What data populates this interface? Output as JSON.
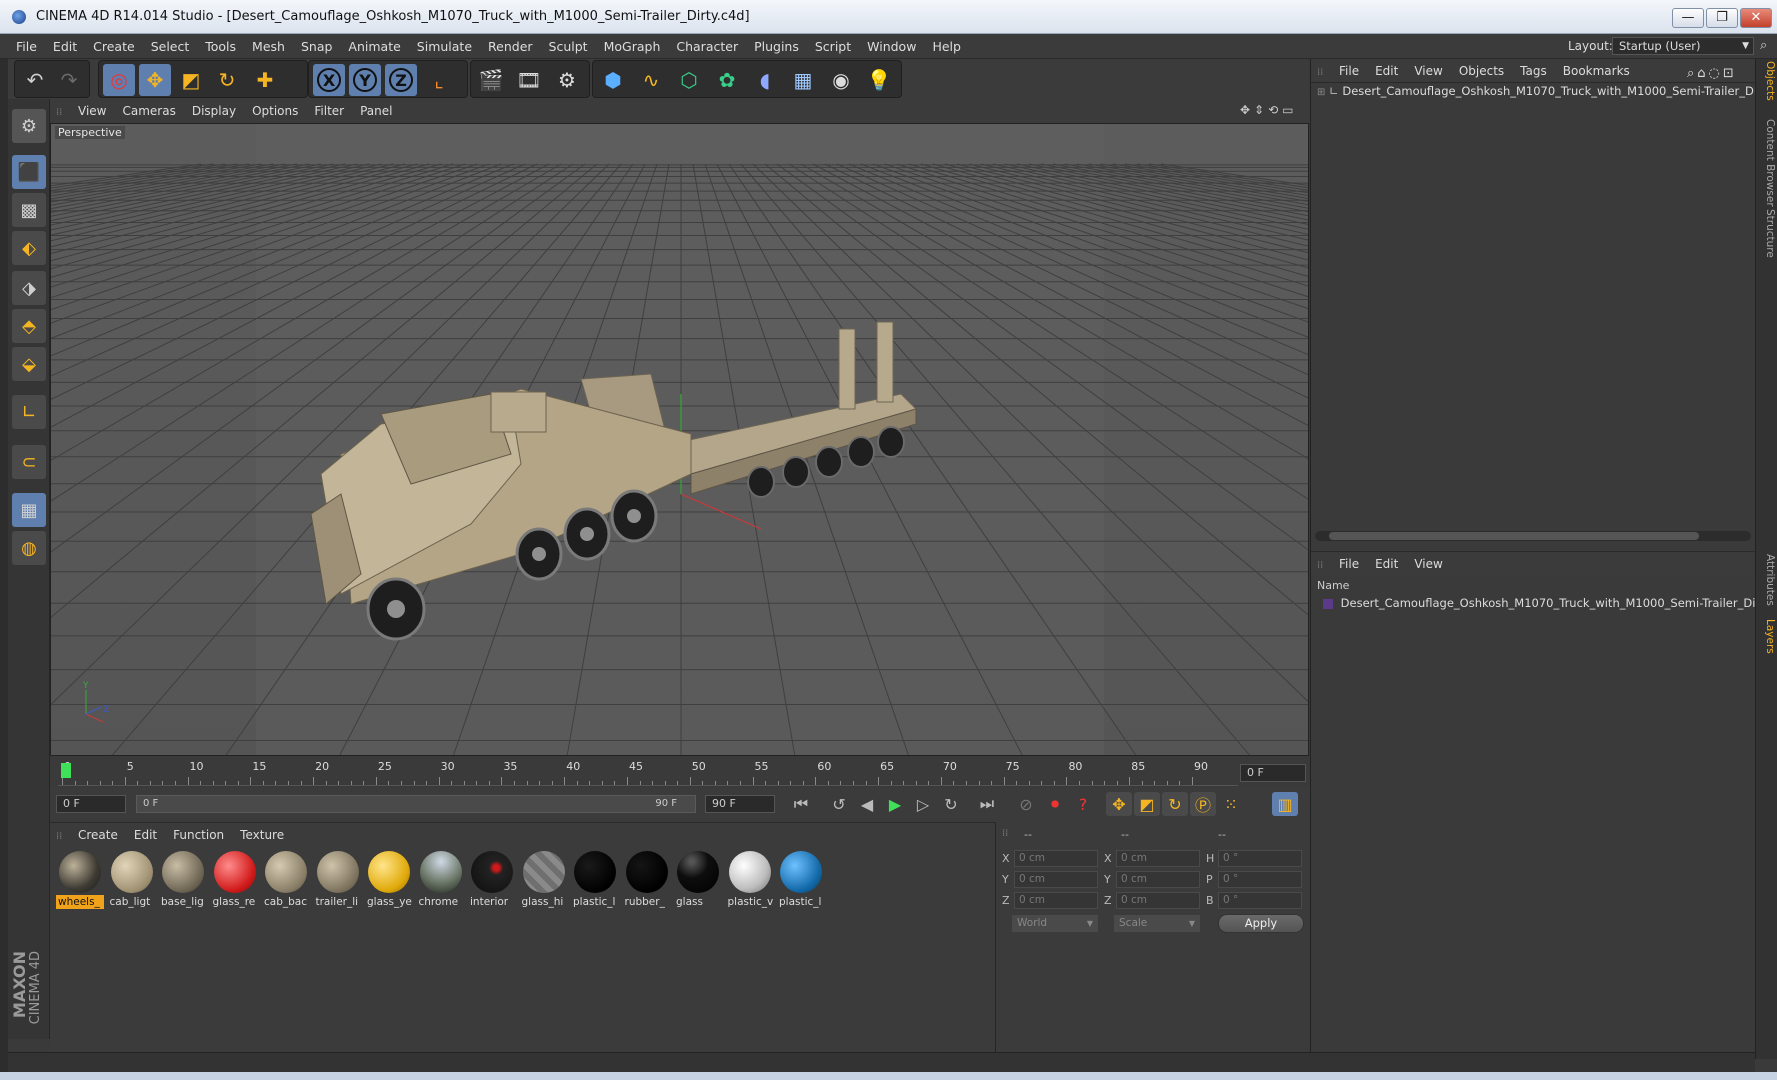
{
  "window": {
    "title": "CINEMA 4D R14.014 Studio - [Desert_Camouflage_Oshkosh_M1070_Truck_with_M1000_Semi-Trailer_Dirty.c4d]",
    "controls": [
      "—",
      "❐",
      "✕"
    ]
  },
  "menubar": {
    "items": [
      "File",
      "Edit",
      "Create",
      "Select",
      "Tools",
      "Mesh",
      "Snap",
      "Animate",
      "Simulate",
      "Render",
      "Sculpt",
      "MoGraph",
      "Character",
      "Plugins",
      "Script",
      "Window",
      "Help"
    ],
    "layout_label": "Layout:",
    "layout_value": "Startup (User)"
  },
  "toolbar": {
    "axis_x": "X",
    "axis_y": "Y",
    "axis_z": "Z"
  },
  "viewport": {
    "menu": [
      "View",
      "Cameras",
      "Display",
      "Options",
      "Filter",
      "Panel"
    ],
    "label": "Perspective"
  },
  "timeline": {
    "ticks": [
      "0",
      "5",
      "10",
      "15",
      "20",
      "25",
      "30",
      "35",
      "40",
      "45",
      "50",
      "55",
      "60",
      "65",
      "70",
      "75",
      "80",
      "85",
      "90"
    ],
    "current_frame_display": "0 F",
    "start_frame": "0 F",
    "range_start": "0 F",
    "range_end": "90 F",
    "end_frame": "90 F"
  },
  "materials": {
    "menu": [
      "Create",
      "Edit",
      "Function",
      "Texture"
    ],
    "items": [
      {
        "label": "wheels_",
        "selected": true
      },
      {
        "label": "cab_ligt"
      },
      {
        "label": "base_lig"
      },
      {
        "label": "glass_re"
      },
      {
        "label": "cab_bac"
      },
      {
        "label": "trailer_li"
      },
      {
        "label": "glass_ye"
      },
      {
        "label": "chrome"
      },
      {
        "label": "interior"
      },
      {
        "label": "glass_hi"
      },
      {
        "label": "plastic_l"
      },
      {
        "label": "rubber_"
      },
      {
        "label": "glass"
      },
      {
        "label": "plastic_v"
      },
      {
        "label": "plastic_l"
      }
    ]
  },
  "coordinates": {
    "headers": [
      "--",
      "--",
      "--"
    ],
    "pos_labels": [
      "X",
      "Y",
      "Z"
    ],
    "size_labels": [
      "X",
      "Y",
      "Z"
    ],
    "rot_labels": [
      "H",
      "P",
      "B"
    ],
    "pos_values": [
      "0 cm",
      "0 cm",
      "0 cm"
    ],
    "size_values": [
      "0 cm",
      "0 cm",
      "0 cm"
    ],
    "rot_values": [
      "0 °",
      "0 °",
      "0 °"
    ],
    "mode": "World",
    "scale_mode": "Scale",
    "apply_label": "Apply"
  },
  "object_manager": {
    "menu": [
      "File",
      "Edit",
      "View",
      "Objects",
      "Tags",
      "Bookmarks"
    ],
    "root_object": "Desert_Camouflage_Oshkosh_M1070_Truck_with_M1000_Semi-Trailer_Dirty"
  },
  "layer_manager": {
    "menu": [
      "File",
      "Edit",
      "View"
    ],
    "column_name": "Name",
    "layer": "Desert_Camouflage_Oshkosh_M1070_Truck_with_M1000_Semi-Trailer_Dirt"
  },
  "side_tabs": [
    "Objects",
    "Content Browser",
    "Structure",
    "Attributes",
    "Layers"
  ],
  "brand": {
    "maxon": "MAXON",
    "cinema": "CINEMA 4D"
  }
}
